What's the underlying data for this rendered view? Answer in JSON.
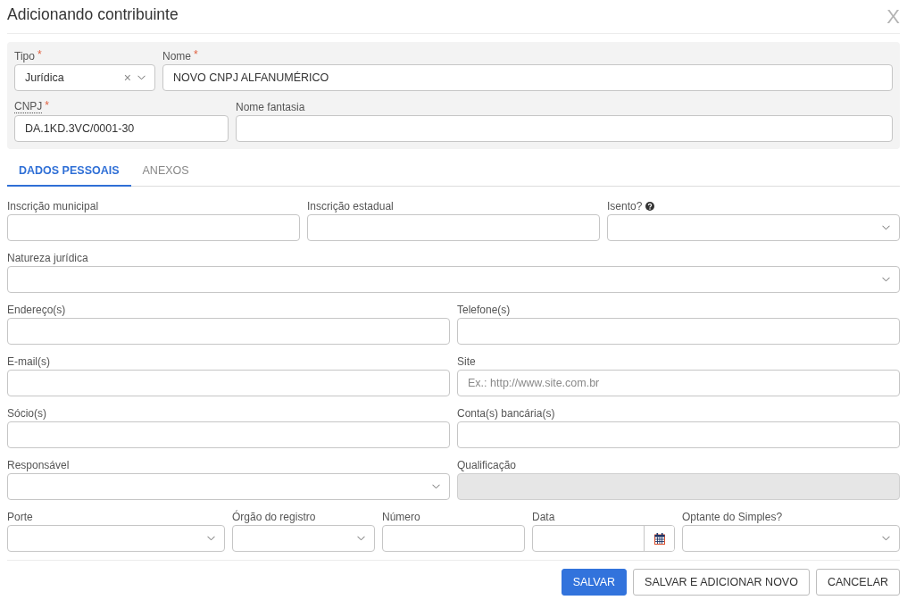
{
  "dialog": {
    "title": "Adicionando contribuinte",
    "close": "X"
  },
  "header": {
    "rows": [
      [
        {
          "label": "Tipo",
          "required_mark": "*",
          "kind": "select",
          "value": "Jurídica",
          "clear": "×",
          "help": false,
          "abbreviation": false,
          "disabled": false
        },
        {
          "label": "Nome",
          "required_mark": "*",
          "kind": "text",
          "value": "NOVO CNPJ ALFANUMÉRICO",
          "help": false,
          "abbreviation": false,
          "disabled": false
        }
      ],
      [
        {
          "label": "CNPJ",
          "required_mark": "*",
          "kind": "text",
          "value": "DA.1KD.3VC/0001-30",
          "help": false,
          "abbreviation": true,
          "disabled": false
        },
        {
          "label": "Nome fantasia",
          "kind": "text",
          "help": false,
          "abbreviation": false,
          "disabled": false
        }
      ]
    ]
  },
  "tabs": [
    {
      "label": "DADOS PESSOAIS",
      "selected": true
    },
    {
      "label": "ANEXOS",
      "selected": false
    }
  ],
  "form": {
    "rows": [
      [
        {
          "label": "Inscrição municipal",
          "kind": "text",
          "help": false,
          "abbreviation": false,
          "disabled": false
        },
        {
          "label": "Inscrição estadual",
          "kind": "text",
          "help": false,
          "abbreviation": false,
          "disabled": false
        },
        {
          "label": "Isento?",
          "kind": "select",
          "help": true,
          "abbreviation": false,
          "disabled": false
        }
      ],
      [
        {
          "label": "Natureza jurídica",
          "kind": "select",
          "help": false,
          "abbreviation": false,
          "disabled": false
        }
      ],
      [
        {
          "label": "Endereço(s)",
          "kind": "text",
          "help": false,
          "abbreviation": false,
          "disabled": false
        },
        {
          "label": "Telefone(s)",
          "kind": "text",
          "help": false,
          "abbreviation": false,
          "disabled": false
        }
      ],
      [
        {
          "label": "E-mail(s)",
          "kind": "text",
          "help": false,
          "abbreviation": false,
          "disabled": false
        },
        {
          "label": "Site",
          "kind": "text",
          "placeholder": "Ex.: http://www.site.com.br",
          "help": false,
          "abbreviation": false,
          "disabled": false
        }
      ],
      [
        {
          "label": "Sócio(s)",
          "kind": "text",
          "help": false,
          "abbreviation": false,
          "disabled": false
        },
        {
          "label": "Conta(s) bancária(s)",
          "kind": "text",
          "help": false,
          "abbreviation": false,
          "disabled": false
        }
      ],
      [
        {
          "label": "Responsável",
          "kind": "select",
          "help": false,
          "abbreviation": false,
          "disabled": false
        },
        {
          "label": "Qualificação",
          "kind": "text",
          "help": false,
          "abbreviation": false,
          "disabled": true
        }
      ],
      [
        {
          "label": "Porte",
          "kind": "select",
          "help": false,
          "abbreviation": false,
          "disabled": false
        },
        {
          "label": "Órgão do registro",
          "kind": "select",
          "help": false,
          "abbreviation": false,
          "disabled": false
        },
        {
          "label": "Número",
          "kind": "text",
          "help": false,
          "abbreviation": false,
          "disabled": false
        },
        {
          "label": "Data",
          "kind": "date",
          "help": false,
          "abbreviation": false,
          "disabled": false
        },
        {
          "label": "Optante do Simples?",
          "kind": "select",
          "help": false,
          "abbreviation": false,
          "disabled": false
        }
      ]
    ]
  },
  "buttons": [
    {
      "label": "SALVAR",
      "kind": "primary"
    },
    {
      "label": "SALVAR E ADICIONAR NOVO",
      "kind": "default"
    },
    {
      "label": "CANCELAR",
      "kind": "default"
    }
  ]
}
